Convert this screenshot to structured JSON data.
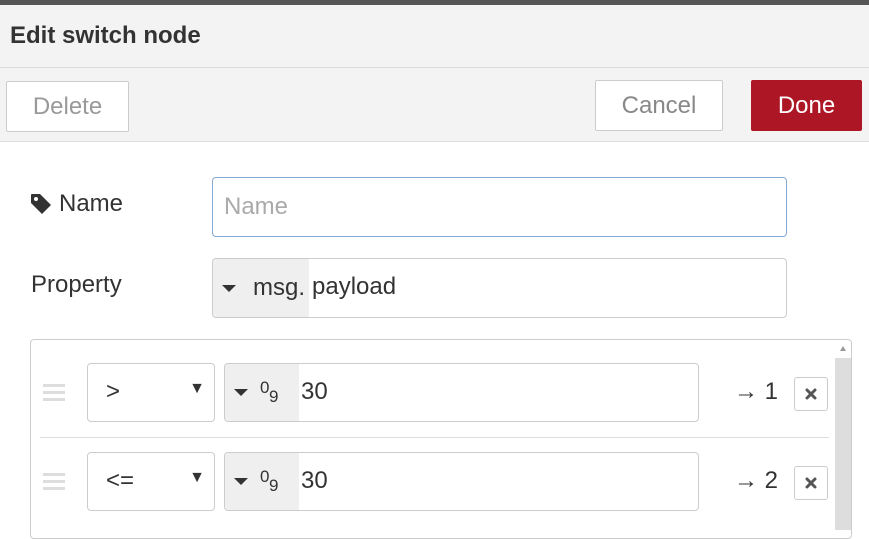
{
  "dialog": {
    "title": "Edit switch node",
    "delete_label": "Delete",
    "cancel_label": "Cancel",
    "done_label": "Done"
  },
  "form": {
    "name_label": "Name",
    "name_placeholder": "Name",
    "name_value": "",
    "property_label": "Property",
    "property_type": "msg.",
    "property_value": "payload"
  },
  "rules": [
    {
      "operator": ">",
      "value_type_icon": "number-type-icon",
      "value": "30",
      "output": "→ 1"
    },
    {
      "operator": "<=",
      "value_type_icon": "number-type-icon",
      "value": "30",
      "output": "→ 2"
    }
  ],
  "colors": {
    "done_button": "#ad1625",
    "focus_border": "#85a9d3"
  }
}
